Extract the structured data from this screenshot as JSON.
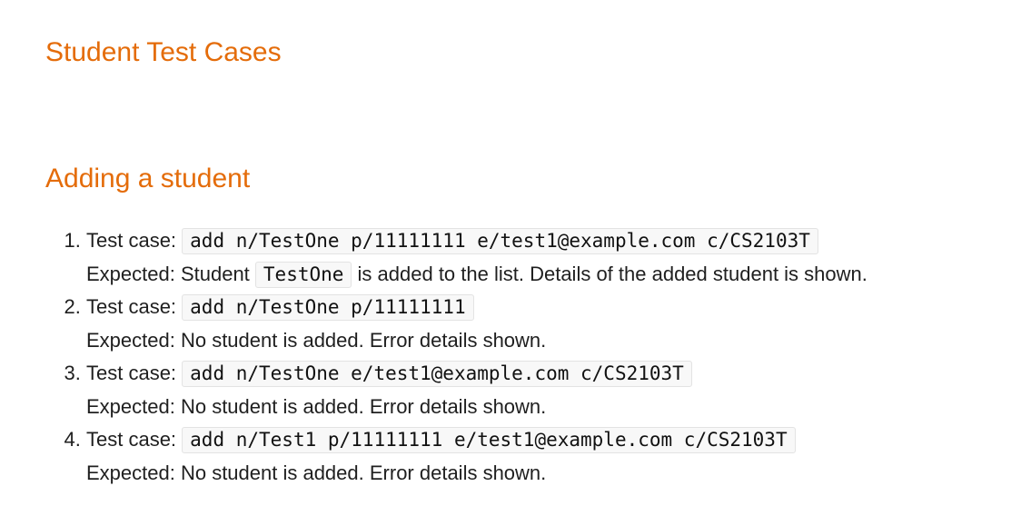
{
  "heading": "Student Test Cases",
  "subheading": "Adding a student",
  "cases": [
    {
      "prefix": "Test case: ",
      "command": "add n/TestOne p/11111111 e/test1@example.com c/CS2103T",
      "expected_before": "Expected: Student ",
      "expected_code": "TestOne",
      "expected_after": " is added to the list. Details of the added student is shown."
    },
    {
      "prefix": "Test case: ",
      "command": "add n/TestOne p/11111111",
      "expected": "Expected: No student is added. Error details shown."
    },
    {
      "prefix": "Test case: ",
      "command": "add n/TestOne e/test1@example.com c/CS2103T",
      "expected": "Expected: No student is added. Error details shown."
    },
    {
      "prefix": "Test case: ",
      "command": "add n/Test1 p/11111111 e/test1@example.com c/CS2103T",
      "expected": "Expected: No student is added. Error details shown."
    }
  ]
}
